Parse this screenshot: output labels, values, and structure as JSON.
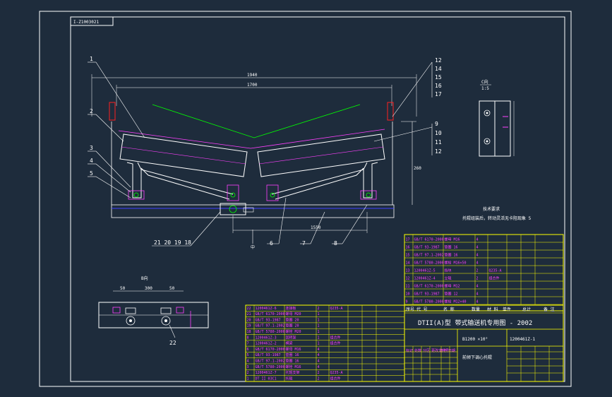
{
  "drawing": {
    "stamp_code": "I-Z1003021",
    "main_dimensions": [
      "1940",
      "1700",
      "1550",
      "260"
    ],
    "section_a_label": "C向",
    "section_a_scale": "1:5",
    "view_b_label": "B向",
    "view_b_dims": [
      "50",
      "300",
      "50"
    ],
    "center_mark": "中",
    "tech_note_title": "技术要求",
    "tech_note_text": "托辊组装后，转动灵活无卡阻现象  5"
  },
  "leaders": {
    "left": [
      "1",
      "2",
      "3",
      "4",
      "5"
    ],
    "right_top": [
      "12",
      "14",
      "15",
      "16",
      "17"
    ],
    "right_mid": [
      "9",
      "10",
      "11",
      "12"
    ],
    "bottom": [
      "21 20 19 18",
      "6",
      "7",
      "8"
    ],
    "view_b": "22"
  },
  "title_block": {
    "project_title": "DTII(A)型   带式输送机专用图 - 2002",
    "spec": "B1200  ×10°",
    "drawing_no": "1200461Z-1",
    "name": "前倾下调心托辊",
    "header_cells": [
      "序号",
      "代  号",
      "名      称",
      "数量",
      "材  料",
      "单件",
      "总计",
      "备  注"
    ],
    "sign_row": [
      "标记",
      "处数",
      "分区",
      "更改文件号",
      "签名",
      "日期"
    ],
    "right_table_rows": [
      [
        "17",
        "GB/T 6170-2000",
        "螺母 M16",
        "4",
        "",
        "",
        "",
        ""
      ],
      [
        "16",
        "GB/T 93-1987",
        "垫圈 16",
        "4",
        "",
        "",
        "",
        ""
      ],
      [
        "15",
        "GB/T 97.1-2002",
        "垫圈 16",
        "4",
        "",
        "",
        "",
        ""
      ],
      [
        "14",
        "GB/T 5780-2000",
        "螺栓 M16×50",
        "4",
        "",
        "",
        "",
        ""
      ],
      [
        "13",
        "1200461Z-5",
        "挡块",
        "2",
        "Q235-A",
        "",
        "",
        ""
      ],
      [
        "12",
        "1200461Z-4",
        "立辊",
        "2",
        "组合件",
        "",
        "",
        ""
      ],
      [
        "11",
        "GB/T 6170-2000",
        "螺母 M12",
        "4",
        "",
        "",
        "",
        ""
      ],
      [
        "10",
        "GB/T 93-1987",
        "垫圈 12",
        "4",
        "",
        "",
        "",
        ""
      ],
      [
        "9",
        "GB/T 5780-2000",
        "螺栓 M12×40",
        "4",
        "",
        "",
        "",
        ""
      ]
    ],
    "left_table_rows": [
      [
        "22",
        "1200461Z-6",
        "连接板",
        "2",
        "Q235-A",
        "",
        "",
        ""
      ],
      [
        "21",
        "GB/T 6170-2000",
        "螺母 M20",
        "1",
        "",
        "",
        "",
        ""
      ],
      [
        "20",
        "GB/T 93-1987",
        "垫圈 20",
        "1",
        "",
        "",
        "",
        ""
      ],
      [
        "19",
        "GB/T 97.1-2002",
        "垫圈 20",
        "1",
        "",
        "",
        "",
        ""
      ],
      [
        "18",
        "GB/T 5780-2000",
        "螺栓 M20",
        "1",
        "",
        "",
        "",
        ""
      ],
      [
        "8",
        "1200461Z-3",
        "回转架",
        "1",
        "组合件",
        "",
        "",
        ""
      ],
      [
        "7",
        "1200461Z-2",
        "横梁",
        "1",
        "组合件",
        "",
        "",
        ""
      ],
      [
        "6",
        "GB/T 6170-2000",
        "螺母 M16",
        "4",
        "",
        "",
        "",
        ""
      ],
      [
        "5",
        "GB/T 93-1987",
        "垫圈 16",
        "4",
        "",
        "",
        "",
        ""
      ],
      [
        "4",
        "GB/T 97.1-2002",
        "垫圈 16",
        "4",
        "",
        "",
        "",
        ""
      ],
      [
        "3",
        "GB/T 5780-2000",
        "螺栓 M16",
        "4",
        "",
        "",
        "",
        ""
      ],
      [
        "2",
        "1200461Z-7",
        "托辊支架",
        "2",
        "Q235-A",
        "",
        "",
        ""
      ],
      [
        "1",
        "DT II 03C1",
        "托辊",
        "2",
        "组合件",
        "",
        "",
        ""
      ]
    ]
  },
  "colors": {
    "background": "#1e2c3c",
    "frame": "#ffffff",
    "table_lines": "#ffff00",
    "parts": "#ff40ff",
    "leaders": "#ffffff",
    "belt": "#00ff00",
    "base": "#4040ff"
  }
}
